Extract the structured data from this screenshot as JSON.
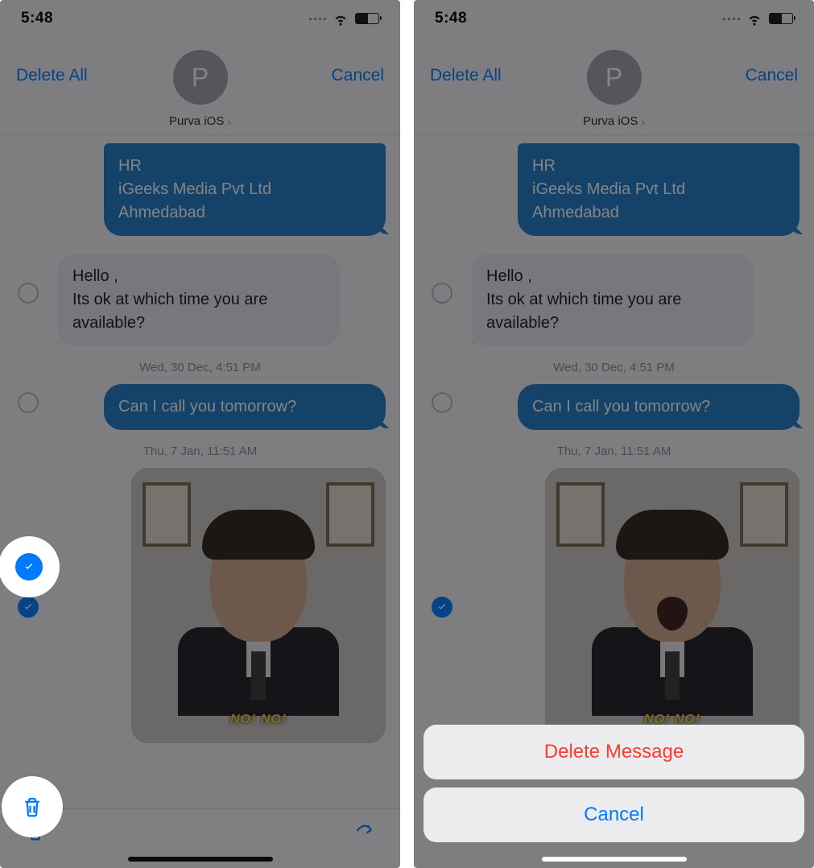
{
  "status": {
    "time": "5:48"
  },
  "nav": {
    "delete_all": "Delete All",
    "cancel": "Cancel",
    "avatar_initial": "P",
    "contact_name": "Purva iOS"
  },
  "msgs": {
    "sent1_line1": "HR",
    "sent1_line2": "iGeeks Media Pvt Ltd",
    "sent1_line3": "Ahmedabad",
    "recv1_line1": "Hello ,",
    "recv1_line2": "Its ok at which time you are available?",
    "ts1": "Wed, 30 Dec, 4:51 PM",
    "sent2": "Can I call you tomorrow?",
    "ts2": "Thu, 7 Jan, 11:51 AM",
    "img_caption": "NO! NO!"
  },
  "sheet": {
    "delete": "Delete Message",
    "cancel": "Cancel"
  }
}
